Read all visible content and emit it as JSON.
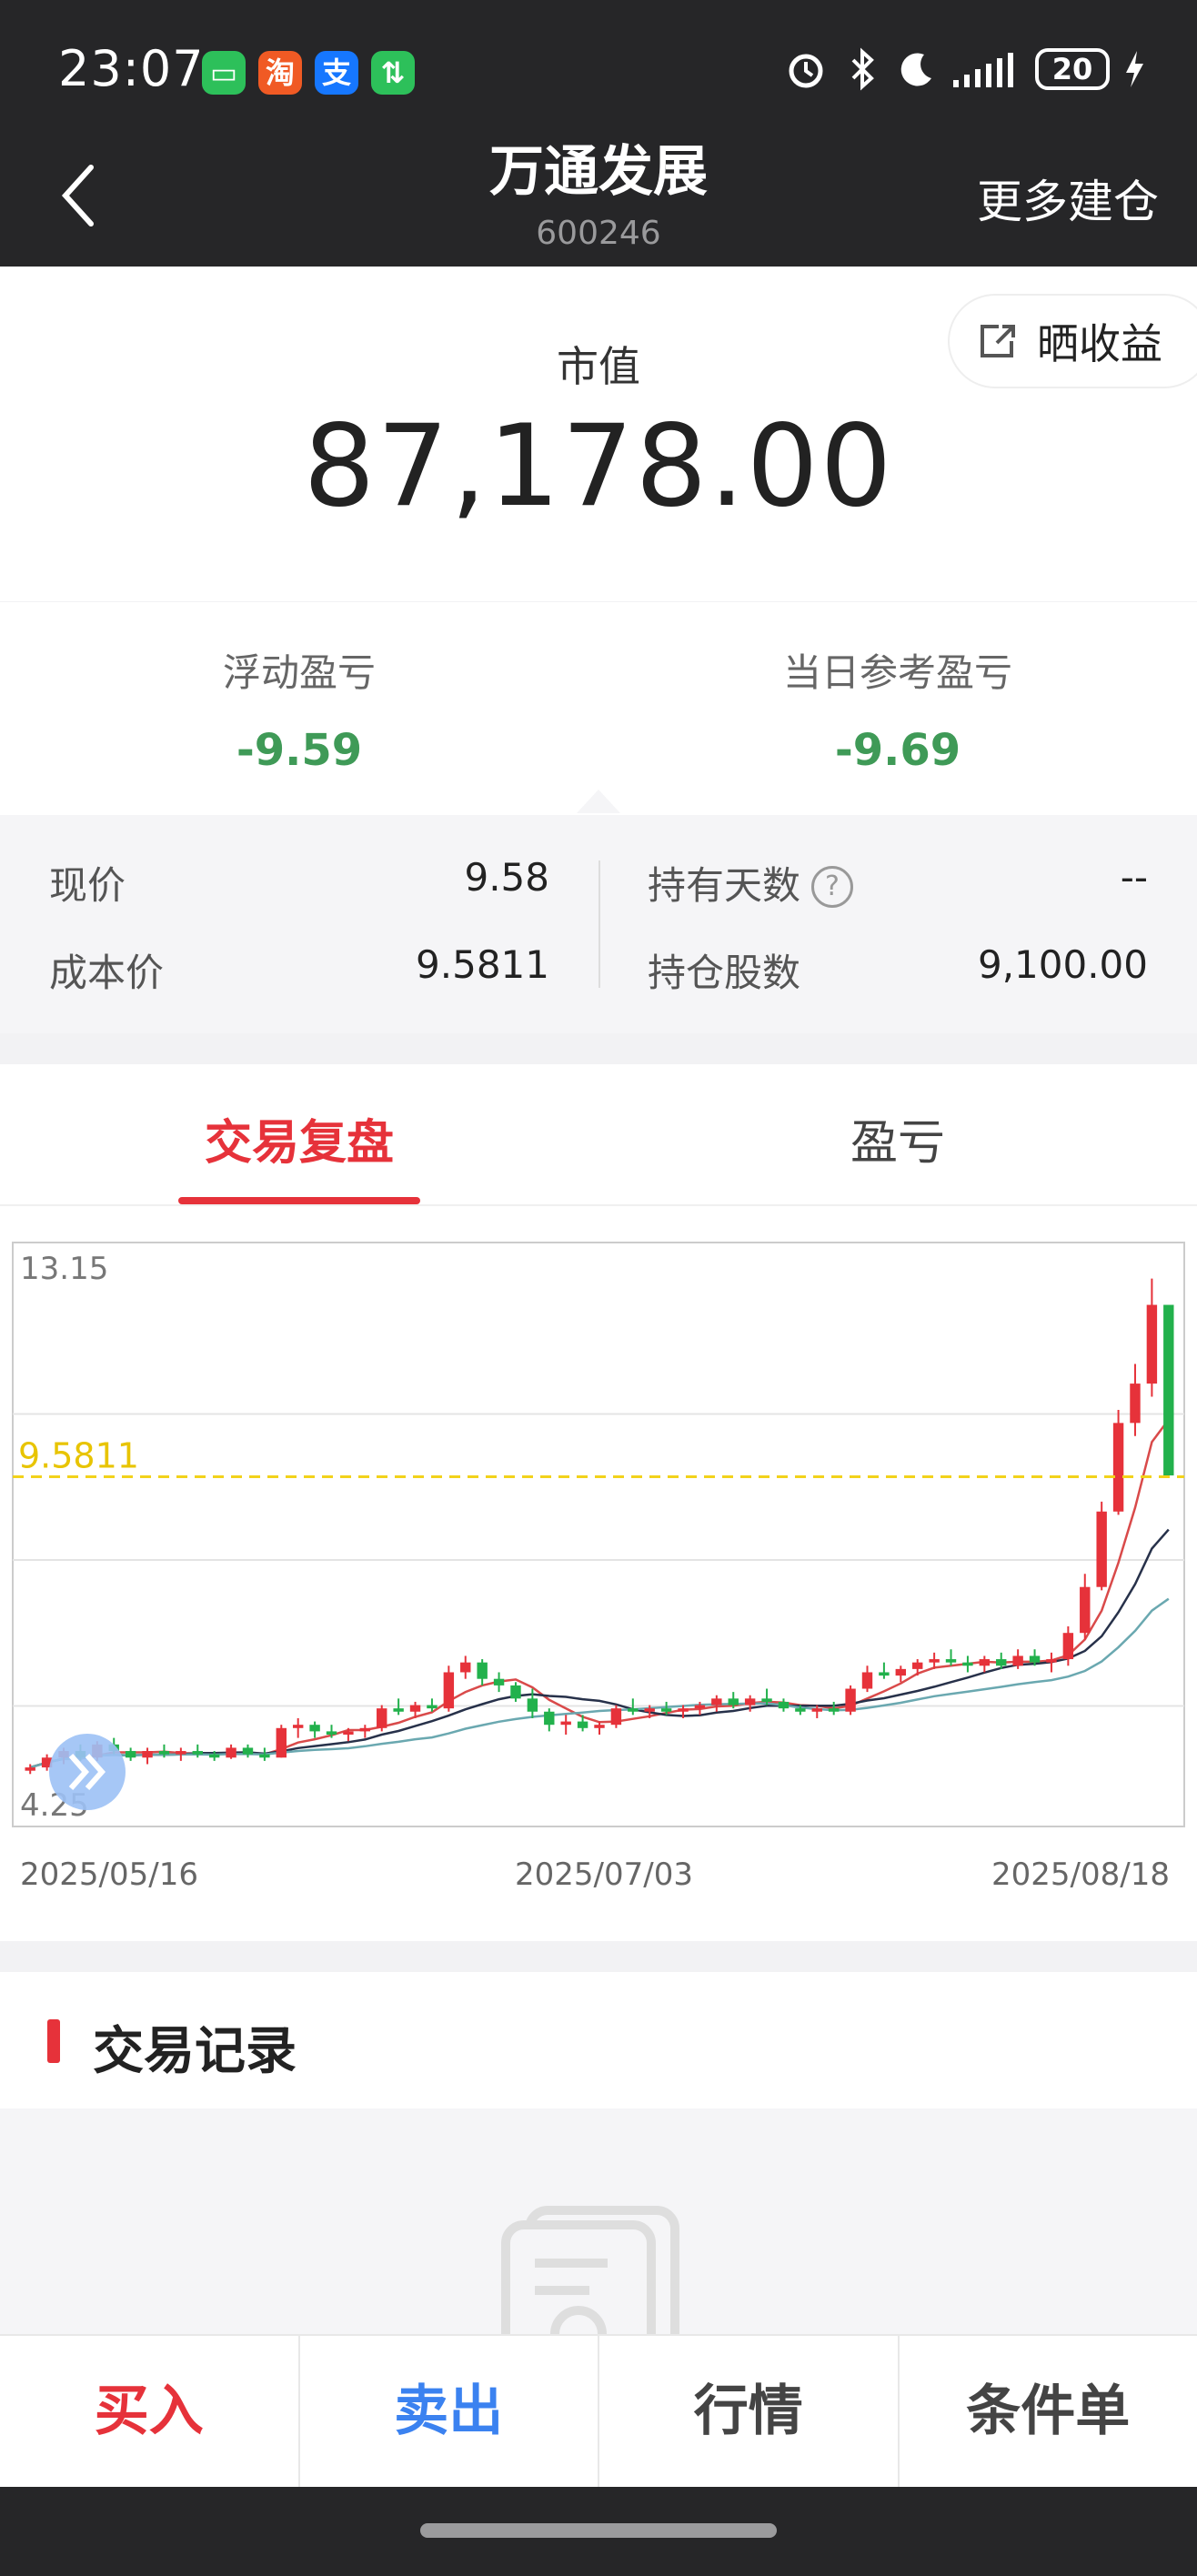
{
  "status_bar": {
    "time": "23:07",
    "apps": [
      {
        "icon": "wechat-icon",
        "glyph": "▭",
        "color": "#2dc05a"
      },
      {
        "icon": "taobao-icon",
        "glyph": "淘",
        "color": "#f05a24"
      },
      {
        "icon": "alipay-icon",
        "glyph": "支",
        "color": "#1677ff"
      },
      {
        "icon": "transfer-icon",
        "glyph": "⇅",
        "color": "#2dc05a"
      }
    ],
    "battery": "20"
  },
  "nav": {
    "title": "万通发展",
    "code": "600246",
    "more": "更多建仓"
  },
  "market_value": {
    "label": "市值",
    "value": "87,178.00",
    "share_label": "晒收益"
  },
  "pnl": {
    "floating_label": "浮动盈亏",
    "floating_value": "-9.59",
    "daily_label": "当日参考盈亏",
    "daily_value": "-9.69"
  },
  "details": {
    "price_label": "现价",
    "price_value": "9.58",
    "cost_label": "成本价",
    "cost_value": "9.5811",
    "days_label": "持有天数",
    "days_value": "--",
    "shares_label": "持仓股数",
    "shares_value": "9,100.00",
    "help_glyph": "?"
  },
  "tabs": [
    {
      "label": "交易复盘",
      "active": true
    },
    {
      "label": "盈亏",
      "active": false
    }
  ],
  "chart_data": {
    "type": "candlestick",
    "y_max_label": "13.15",
    "y_min_label": "4.25",
    "ylim": [
      4.25,
      13.15
    ],
    "cost_line": {
      "value": 9.5811,
      "label": "9.5811",
      "color": "#f2d21b"
    },
    "x_labels": [
      "2025/05/16",
      "2025/07/03",
      "2025/08/18"
    ],
    "up_color": "#e6323a",
    "down_color": "#22b14c",
    "candles": [
      [
        5.1,
        5.2,
        5.05,
        5.15
      ],
      [
        5.15,
        5.35,
        5.1,
        5.3
      ],
      [
        5.3,
        5.45,
        5.2,
        5.4
      ],
      [
        5.4,
        5.5,
        5.25,
        5.3
      ],
      [
        5.3,
        5.55,
        5.25,
        5.5
      ],
      [
        5.5,
        5.6,
        5.35,
        5.4
      ],
      [
        5.4,
        5.45,
        5.25,
        5.3
      ],
      [
        5.3,
        5.45,
        5.2,
        5.4
      ],
      [
        5.4,
        5.5,
        5.3,
        5.35
      ],
      [
        5.35,
        5.45,
        5.25,
        5.4
      ],
      [
        5.4,
        5.5,
        5.3,
        5.35
      ],
      [
        5.35,
        5.4,
        5.25,
        5.3
      ],
      [
        5.3,
        5.5,
        5.28,
        5.45
      ],
      [
        5.45,
        5.5,
        5.3,
        5.35
      ],
      [
        5.35,
        5.45,
        5.25,
        5.3
      ],
      [
        5.3,
        5.8,
        5.3,
        5.75
      ],
      [
        5.75,
        5.9,
        5.6,
        5.8
      ],
      [
        5.8,
        5.85,
        5.6,
        5.7
      ],
      [
        5.7,
        5.8,
        5.6,
        5.65
      ],
      [
        5.65,
        5.75,
        5.55,
        5.7
      ],
      [
        5.7,
        5.8,
        5.6,
        5.75
      ],
      [
        5.75,
        6.1,
        5.7,
        6.05
      ],
      [
        6.05,
        6.2,
        5.95,
        6.0
      ],
      [
        6.0,
        6.15,
        5.9,
        6.1
      ],
      [
        6.1,
        6.2,
        6.0,
        6.05
      ],
      [
        6.05,
        6.7,
        6.0,
        6.6
      ],
      [
        6.6,
        6.85,
        6.5,
        6.75
      ],
      [
        6.75,
        6.8,
        6.4,
        6.5
      ],
      [
        6.5,
        6.6,
        6.3,
        6.4
      ],
      [
        6.4,
        6.45,
        6.15,
        6.2
      ],
      [
        6.2,
        6.35,
        5.9,
        6.0
      ],
      [
        6.0,
        6.05,
        5.7,
        5.8
      ],
      [
        5.8,
        5.95,
        5.65,
        5.85
      ],
      [
        5.85,
        5.95,
        5.7,
        5.75
      ],
      [
        5.75,
        5.85,
        5.65,
        5.8
      ],
      [
        5.8,
        6.1,
        5.75,
        6.05
      ],
      [
        6.05,
        6.2,
        5.95,
        6.0
      ],
      [
        6.0,
        6.1,
        5.9,
        6.05
      ],
      [
        6.05,
        6.15,
        5.95,
        6.0
      ],
      [
        6.0,
        6.1,
        5.9,
        6.05
      ],
      [
        6.05,
        6.15,
        5.95,
        6.1
      ],
      [
        6.1,
        6.25,
        6.0,
        6.2
      ],
      [
        6.2,
        6.3,
        6.05,
        6.1
      ],
      [
        6.1,
        6.25,
        6.0,
        6.2
      ],
      [
        6.2,
        6.35,
        6.1,
        6.15
      ],
      [
        6.15,
        6.2,
        6.0,
        6.05
      ],
      [
        6.05,
        6.1,
        5.95,
        6.0
      ],
      [
        6.0,
        6.1,
        5.9,
        6.05
      ],
      [
        6.05,
        6.15,
        5.95,
        6.0
      ],
      [
        6.0,
        6.4,
        5.95,
        6.35
      ],
      [
        6.35,
        6.7,
        6.3,
        6.6
      ],
      [
        6.6,
        6.75,
        6.5,
        6.55
      ],
      [
        6.55,
        6.7,
        6.45,
        6.65
      ],
      [
        6.65,
        6.8,
        6.55,
        6.75
      ],
      [
        6.75,
        6.9,
        6.65,
        6.8
      ],
      [
        6.8,
        6.95,
        6.7,
        6.75
      ],
      [
        6.75,
        6.85,
        6.6,
        6.7
      ],
      [
        6.7,
        6.85,
        6.6,
        6.8
      ],
      [
        6.8,
        6.9,
        6.65,
        6.7
      ],
      [
        6.7,
        6.95,
        6.65,
        6.85
      ],
      [
        6.85,
        6.95,
        6.7,
        6.75
      ],
      [
        6.75,
        6.9,
        6.6,
        6.8
      ],
      [
        6.8,
        7.3,
        6.7,
        7.2
      ],
      [
        7.2,
        8.1,
        7.1,
        7.9
      ],
      [
        7.9,
        9.2,
        7.85,
        9.05
      ],
      [
        9.05,
        10.6,
        9.0,
        10.4
      ],
      [
        10.4,
        11.3,
        10.2,
        11.0
      ],
      [
        11.0,
        12.6,
        10.8,
        12.2
      ],
      [
        12.2,
        11.9,
        9.8,
        9.6
      ]
    ]
  },
  "records": {
    "title": "交易记录"
  },
  "bottom_bar": {
    "buy": "买入",
    "sell": "卖出",
    "quote": "行情",
    "conditional": "条件单"
  }
}
